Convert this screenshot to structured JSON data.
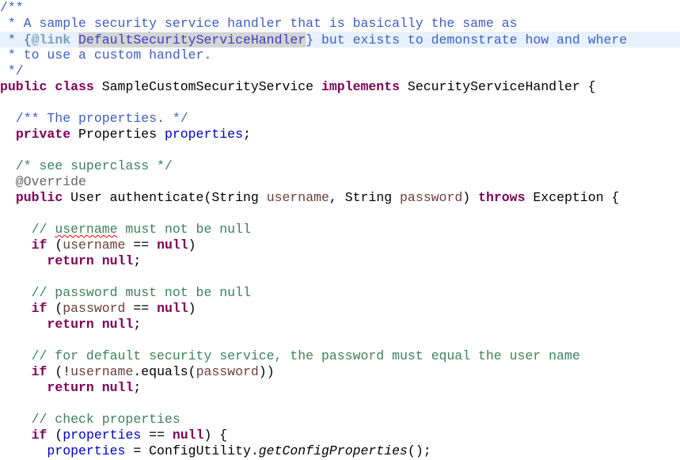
{
  "editor": {
    "lines": [
      {
        "tokens": [
          {
            "t": "/**",
            "c": "javadoc"
          }
        ]
      },
      {
        "tokens": [
          {
            "t": " * A sample security service handler that is basically the same as",
            "c": "javadoc"
          }
        ]
      },
      {
        "current": true,
        "tokens": [
          {
            "t": " * {",
            "c": "javadoc"
          },
          {
            "t": "@link",
            "c": "jdtag"
          },
          {
            "t": " ",
            "c": "javadoc"
          },
          {
            "t": "DefaultSe",
            "c": "link hl"
          },
          {
            "caret": true
          },
          {
            "t": "curityServiceHandler",
            "c": "link hl"
          },
          {
            "t": "} but exists to demonstrate how and where",
            "c": "javadoc"
          }
        ]
      },
      {
        "tokens": [
          {
            "t": " * to use a custom handler.",
            "c": "javadoc"
          }
        ]
      },
      {
        "tokens": [
          {
            "t": " */",
            "c": "javadoc"
          }
        ]
      },
      {
        "tokens": [
          {
            "t": "public",
            "c": "keyword"
          },
          {
            "t": " ",
            "c": "plain"
          },
          {
            "t": "class",
            "c": "keyword"
          },
          {
            "t": " SampleCustomSecurityService ",
            "c": "plain"
          },
          {
            "t": "implements",
            "c": "keyword"
          },
          {
            "t": " SecurityServiceHandler {",
            "c": "plain"
          }
        ]
      },
      {
        "tokens": []
      },
      {
        "tokens": [
          {
            "t": "  /** The properties. */",
            "c": "javadoc"
          }
        ]
      },
      {
        "tokens": [
          {
            "t": "  ",
            "c": "plain"
          },
          {
            "t": "private",
            "c": "keyword"
          },
          {
            "t": " Properties ",
            "c": "plain"
          },
          {
            "t": "properties",
            "c": "field"
          },
          {
            "t": ";",
            "c": "plain"
          }
        ]
      },
      {
        "tokens": []
      },
      {
        "tokens": [
          {
            "t": "  /* see superclass */",
            "c": "comment"
          }
        ]
      },
      {
        "tokens": [
          {
            "t": "  @Override",
            "c": "annot"
          }
        ]
      },
      {
        "tokens": [
          {
            "t": "  ",
            "c": "plain"
          },
          {
            "t": "public",
            "c": "keyword"
          },
          {
            "t": " User authenticate(String ",
            "c": "plain"
          },
          {
            "t": "username",
            "c": "param"
          },
          {
            "t": ", String ",
            "c": "plain"
          },
          {
            "t": "password",
            "c": "param"
          },
          {
            "t": ") ",
            "c": "plain"
          },
          {
            "t": "throws",
            "c": "keyword"
          },
          {
            "t": " Exception {",
            "c": "plain"
          }
        ]
      },
      {
        "tokens": []
      },
      {
        "tokens": [
          {
            "t": "    // ",
            "c": "comment"
          },
          {
            "t": "username",
            "c": "comment spell"
          },
          {
            "t": " must not be null",
            "c": "comment"
          }
        ]
      },
      {
        "tokens": [
          {
            "t": "    ",
            "c": "plain"
          },
          {
            "t": "if",
            "c": "keyword"
          },
          {
            "t": " (",
            "c": "plain"
          },
          {
            "t": "username",
            "c": "param"
          },
          {
            "t": " == ",
            "c": "plain"
          },
          {
            "t": "null",
            "c": "keyword"
          },
          {
            "t": ")",
            "c": "plain"
          }
        ]
      },
      {
        "tokens": [
          {
            "t": "      ",
            "c": "plain"
          },
          {
            "t": "return",
            "c": "keyword"
          },
          {
            "t": " ",
            "c": "plain"
          },
          {
            "t": "null",
            "c": "keyword"
          },
          {
            "t": ";",
            "c": "plain"
          }
        ]
      },
      {
        "tokens": []
      },
      {
        "tokens": [
          {
            "t": "    // password must not be null",
            "c": "comment"
          }
        ]
      },
      {
        "tokens": [
          {
            "t": "    ",
            "c": "plain"
          },
          {
            "t": "if",
            "c": "keyword"
          },
          {
            "t": " (",
            "c": "plain"
          },
          {
            "t": "password",
            "c": "param"
          },
          {
            "t": " == ",
            "c": "plain"
          },
          {
            "t": "null",
            "c": "keyword"
          },
          {
            "t": ")",
            "c": "plain"
          }
        ]
      },
      {
        "tokens": [
          {
            "t": "      ",
            "c": "plain"
          },
          {
            "t": "return",
            "c": "keyword"
          },
          {
            "t": " ",
            "c": "plain"
          },
          {
            "t": "null",
            "c": "keyword"
          },
          {
            "t": ";",
            "c": "plain"
          }
        ]
      },
      {
        "tokens": []
      },
      {
        "tokens": [
          {
            "t": "    // for default security service, the password must equal the user name",
            "c": "comment"
          }
        ]
      },
      {
        "tokens": [
          {
            "t": "    ",
            "c": "plain"
          },
          {
            "t": "if",
            "c": "keyword"
          },
          {
            "t": " (!",
            "c": "plain"
          },
          {
            "t": "username",
            "c": "param"
          },
          {
            "t": ".equals(",
            "c": "plain"
          },
          {
            "t": "password",
            "c": "param"
          },
          {
            "t": "))",
            "c": "plain"
          }
        ]
      },
      {
        "tokens": [
          {
            "t": "      ",
            "c": "plain"
          },
          {
            "t": "return",
            "c": "keyword"
          },
          {
            "t": " ",
            "c": "plain"
          },
          {
            "t": "null",
            "c": "keyword"
          },
          {
            "t": ";",
            "c": "plain"
          }
        ]
      },
      {
        "tokens": []
      },
      {
        "tokens": [
          {
            "t": "    // check properties",
            "c": "comment"
          }
        ]
      },
      {
        "tokens": [
          {
            "t": "    ",
            "c": "plain"
          },
          {
            "t": "if",
            "c": "keyword"
          },
          {
            "t": " (",
            "c": "plain"
          },
          {
            "t": "properties",
            "c": "field"
          },
          {
            "t": " == ",
            "c": "plain"
          },
          {
            "t": "null",
            "c": "keyword"
          },
          {
            "t": ") {",
            "c": "plain"
          }
        ]
      },
      {
        "tokens": [
          {
            "t": "      ",
            "c": "plain"
          },
          {
            "t": "properties",
            "c": "field"
          },
          {
            "t": " = ConfigUtility.",
            "c": "plain"
          },
          {
            "t": "getConfigProperties",
            "c": "static"
          },
          {
            "t": "();",
            "c": "plain"
          }
        ]
      }
    ]
  }
}
